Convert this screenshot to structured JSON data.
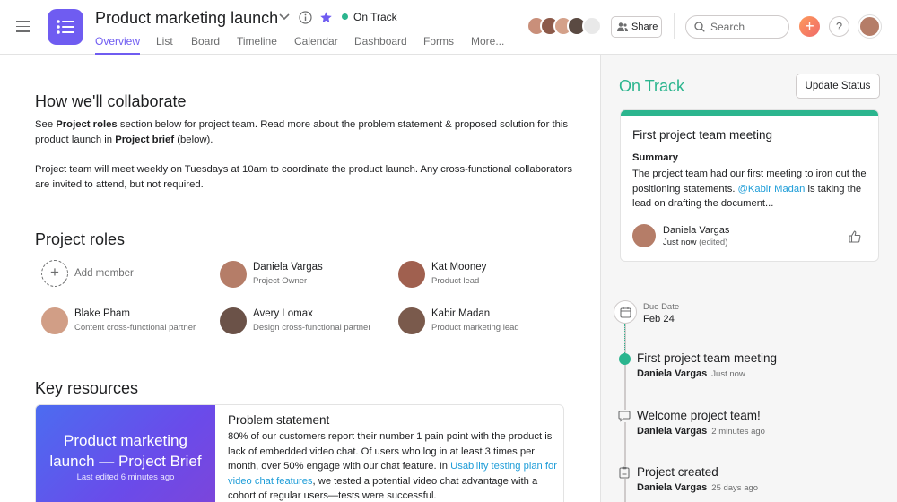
{
  "header": {
    "project_title": "Product marketing launch",
    "status": "On Track",
    "tabs": [
      {
        "label": "Overview",
        "active": true
      },
      {
        "label": "List"
      },
      {
        "label": "Board"
      },
      {
        "label": "Timeline"
      },
      {
        "label": "Calendar"
      },
      {
        "label": "Dashboard"
      },
      {
        "label": "Forms"
      },
      {
        "label": "More..."
      }
    ],
    "share_label": "Share",
    "search_placeholder": "Search",
    "plus_label": "+",
    "help_label": "?"
  },
  "collaborate": {
    "heading": "How we'll collaborate",
    "p1_a": "See ",
    "p1_b": "Project roles",
    "p1_c": " section below for project team. Read more about the problem statement & proposed solution for this product launch in ",
    "p1_d": "Project brief",
    "p1_e": " (below).",
    "p2": "Project team will meet weekly on Tuesdays at 10am to coordinate the product launch. Any cross-functional collaborators are invited to attend, but not required."
  },
  "roles": {
    "heading": "Project roles",
    "add_member": "Add member",
    "members": [
      {
        "name": "Daniela Vargas",
        "role": "Project Owner"
      },
      {
        "name": "Kat Mooney",
        "role": "Product lead"
      },
      {
        "name": "Blake Pham",
        "role": "Content cross-functional partner"
      },
      {
        "name": "Avery Lomax",
        "role": "Design cross-functional partner"
      },
      {
        "name": "Kabir Madan",
        "role": "Product marketing lead"
      }
    ]
  },
  "resources": {
    "heading": "Key resources",
    "brief_title_1": "Product marketing",
    "brief_title_2": "launch — Project Brief",
    "brief_edited": "Last edited 6 minutes ago",
    "problem_title": "Problem statement",
    "problem_text_a": "80% of our customers report their number 1 pain point with the product is lack of embedded video chat. Of users who log in at least 3 times per month, over 50% engage with our chat feature. In ",
    "problem_link": "Usability testing plan for video chat features",
    "problem_text_b": ", we tested a potential video chat advantage with a cohort of regular users—tests were successful."
  },
  "status_panel": {
    "title": "On Track",
    "update_button": "Update Status",
    "card": {
      "title": "First project team meeting",
      "summary_label": "Summary",
      "text_a": "The project team had our first meeting to iron out the positioning statements. ",
      "mention": "@Kabir Madan",
      "text_b": " is taking the lead on drafting the document...",
      "author": "Daniela Vargas",
      "time": "Just now",
      "edited": "(edited)"
    },
    "due_label": "Due Date",
    "due_date": "Feb 24",
    "timeline": [
      {
        "title": "First project team meeting",
        "author": "Daniela Vargas",
        "time": "Just now"
      },
      {
        "title": "Welcome project team!",
        "author": "Daniela Vargas",
        "time": "2 minutes ago"
      },
      {
        "title": "Project created",
        "author": "Daniela Vargas",
        "time": "25 days ago"
      }
    ]
  },
  "colors": {
    "accent": "#6f5cf1",
    "on_track": "#2bb58e",
    "link": "#1e9dd8"
  }
}
